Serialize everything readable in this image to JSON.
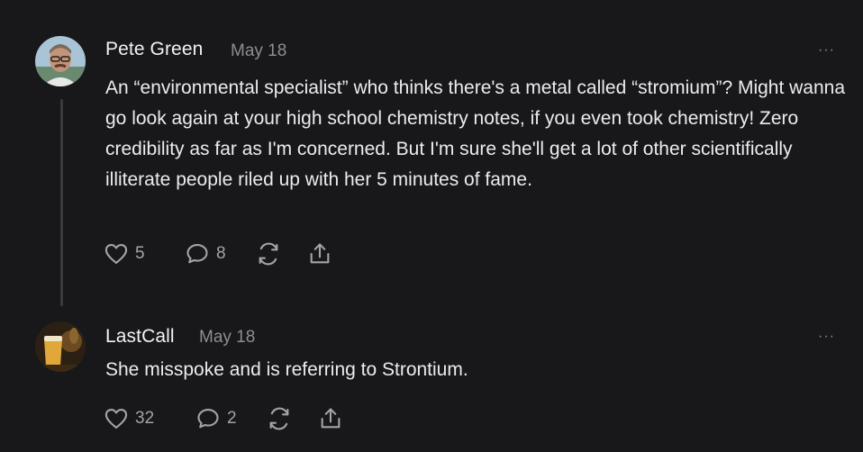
{
  "comments": [
    {
      "author": "Pete Green",
      "date": "May 18",
      "more_label": "···",
      "text": "An “environmental specialist” who thinks there's a metal called “stromium”? Might wanna go look again at your high school chemistry notes, if you even took chemistry! Zero credibility as far as I'm concerned. But I'm sure she'll get a lot of other scientifically illiterate people riled up with her 5 minutes of fame.",
      "likes": "5",
      "replies": "8"
    },
    {
      "author": "LastCall",
      "date": "May 18",
      "more_label": "···",
      "text": "She misspoke and is referring to Strontium.",
      "likes": "32",
      "replies": "2"
    }
  ]
}
